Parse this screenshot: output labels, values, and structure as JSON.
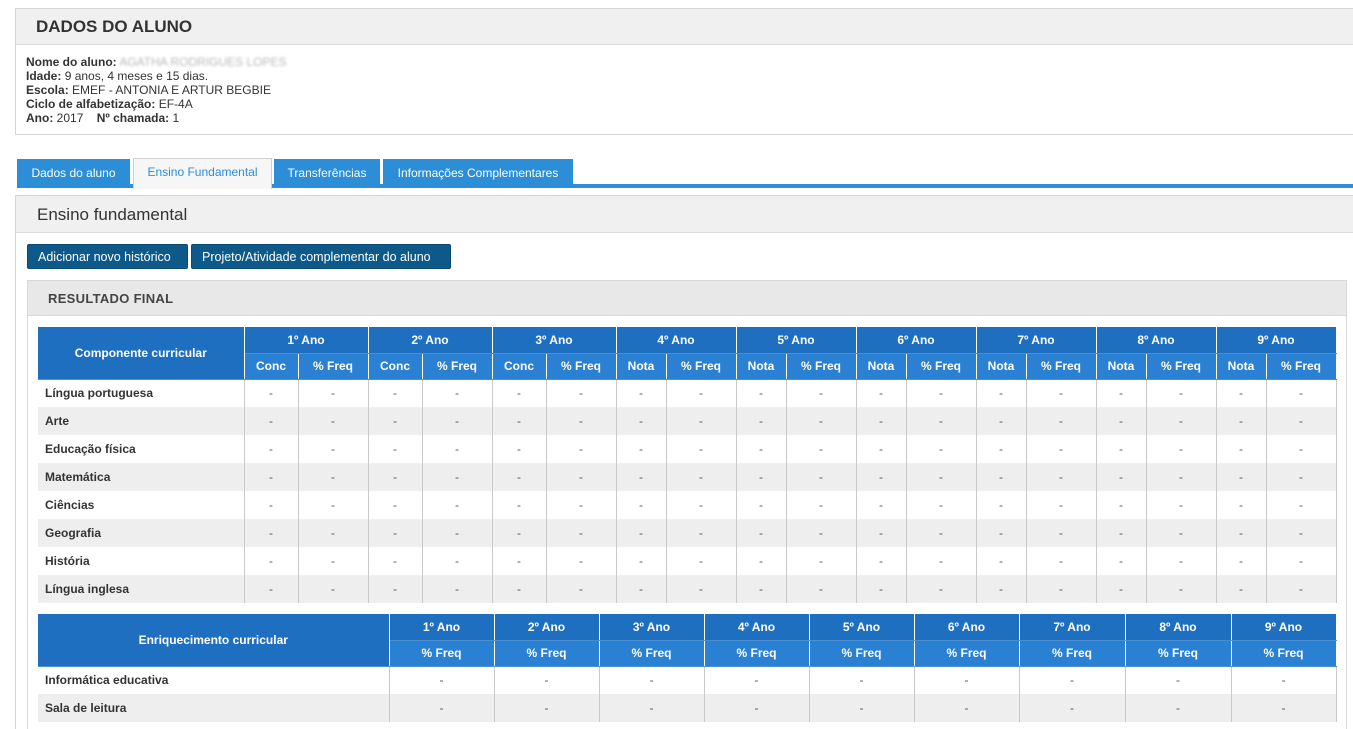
{
  "student": {
    "title": "DADOS DO ALUNO",
    "name_label": "Nome do aluno:",
    "name_value": "AGATHA RODRIGUES LOPES",
    "age_label": "Idade:",
    "age_value": "9 anos, 4 meses e 15 dias.",
    "school_label": "Escola:",
    "school_value": "EMEF - ANTONIA E ARTUR BEGBIE",
    "cycle_label": "Ciclo de alfabetização:",
    "cycle_value": "EF-4A",
    "year_label": "Ano:",
    "year_value": "2017",
    "call_label": "Nº chamada:",
    "call_value": "1"
  },
  "tabs": [
    {
      "label": "Dados do aluno"
    },
    {
      "label": "Ensino Fundamental"
    },
    {
      "label": "Transferências"
    },
    {
      "label": "Informações Complementares"
    }
  ],
  "content": {
    "title": "Ensino fundamental",
    "add_history_button": "Adicionar novo histórico",
    "project_button": "Projeto/Atividade complementar do aluno",
    "result_title": "RESULTADO FINAL"
  },
  "table1": {
    "first_header": "Componente curricular",
    "years": [
      "1º Ano",
      "2º Ano",
      "3º Ano",
      "4º Ano",
      "5º Ano",
      "6º Ano",
      "7º Ano",
      "8º Ano",
      "9º Ano"
    ],
    "subheaders": [
      [
        "Conc",
        "% Freq"
      ],
      [
        "Conc",
        "% Freq"
      ],
      [
        "Conc",
        "% Freq"
      ],
      [
        "Nota",
        "% Freq"
      ],
      [
        "Nota",
        "% Freq"
      ],
      [
        "Nota",
        "% Freq"
      ],
      [
        "Nota",
        "% Freq"
      ],
      [
        "Nota",
        "% Freq"
      ],
      [
        "Nota",
        "% Freq"
      ]
    ],
    "rows": [
      {
        "label": "Língua portuguesa",
        "values": [
          "-",
          "-",
          "-",
          "-",
          "-",
          "-",
          "-",
          "-",
          "-",
          "-",
          "-",
          "-",
          "-",
          "-",
          "-",
          "-",
          "-",
          "-"
        ]
      },
      {
        "label": "Arte",
        "values": [
          "-",
          "-",
          "-",
          "-",
          "-",
          "-",
          "-",
          "-",
          "-",
          "-",
          "-",
          "-",
          "-",
          "-",
          "-",
          "-",
          "-",
          "-"
        ]
      },
      {
        "label": "Educação física",
        "values": [
          "-",
          "-",
          "-",
          "-",
          "-",
          "-",
          "-",
          "-",
          "-",
          "-",
          "-",
          "-",
          "-",
          "-",
          "-",
          "-",
          "-",
          "-"
        ]
      },
      {
        "label": "Matemática",
        "values": [
          "-",
          "-",
          "-",
          "-",
          "-",
          "-",
          "-",
          "-",
          "-",
          "-",
          "-",
          "-",
          "-",
          "-",
          "-",
          "-",
          "-",
          "-"
        ]
      },
      {
        "label": "Ciências",
        "values": [
          "-",
          "-",
          "-",
          "-",
          "-",
          "-",
          "-",
          "-",
          "-",
          "-",
          "-",
          "-",
          "-",
          "-",
          "-",
          "-",
          "-",
          "-"
        ]
      },
      {
        "label": "Geografia",
        "values": [
          "-",
          "-",
          "-",
          "-",
          "-",
          "-",
          "-",
          "-",
          "-",
          "-",
          "-",
          "-",
          "-",
          "-",
          "-",
          "-",
          "-",
          "-"
        ]
      },
      {
        "label": "História",
        "values": [
          "-",
          "-",
          "-",
          "-",
          "-",
          "-",
          "-",
          "-",
          "-",
          "-",
          "-",
          "-",
          "-",
          "-",
          "-",
          "-",
          "-",
          "-"
        ]
      },
      {
        "label": "Língua inglesa",
        "values": [
          "-",
          "-",
          "-",
          "-",
          "-",
          "-",
          "-",
          "-",
          "-",
          "-",
          "-",
          "-",
          "-",
          "-",
          "-",
          "-",
          "-",
          "-"
        ]
      }
    ]
  },
  "table2": {
    "first_header": "Enriquecimento curricular",
    "years": [
      "1º Ano",
      "2º Ano",
      "3º Ano",
      "4º Ano",
      "5º Ano",
      "6º Ano",
      "7º Ano",
      "8º Ano",
      "9º Ano"
    ],
    "subheader": "% Freq",
    "rows": [
      {
        "label": "Informática educativa",
        "values": [
          "-",
          "-",
          "-",
          "-",
          "-",
          "-",
          "-",
          "-",
          "-"
        ]
      },
      {
        "label": "Sala de leitura",
        "values": [
          "-",
          "-",
          "-",
          "-",
          "-",
          "-",
          "-",
          "-",
          "-"
        ]
      }
    ]
  }
}
